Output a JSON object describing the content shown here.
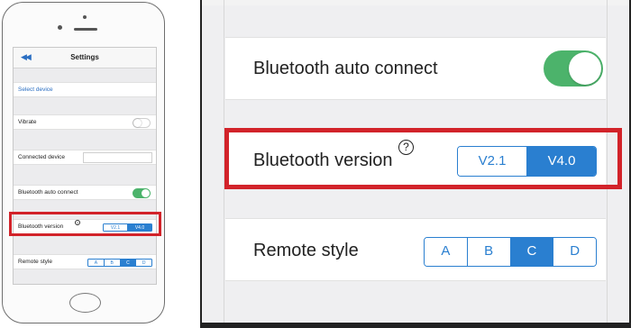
{
  "phone": {
    "nav": {
      "back_icon": "double-left-arrow",
      "title": "Settings"
    },
    "rows": {
      "select_device": "Select device",
      "vibrate": {
        "label": "Vibrate",
        "on": false
      },
      "connected_device": {
        "label": "Connected device",
        "value": ""
      },
      "bluetooth_auto_connect": {
        "label": "Bluetooth auto connect",
        "on": true
      },
      "bluetooth_version": {
        "label": "Bluetooth version",
        "help_icon": "?",
        "options": [
          "V2.1",
          "V4.0"
        ],
        "selected": "V4.0"
      },
      "remote_style": {
        "label": "Remote style",
        "options": [
          "A",
          "B",
          "C",
          "D"
        ],
        "selected": "C"
      }
    }
  },
  "zoom": {
    "bluetooth_auto_connect": {
      "label": "Bluetooth auto connect",
      "on": true
    },
    "bluetooth_version": {
      "label": "Bluetooth version",
      "help_icon": "?",
      "options": [
        "V2.1",
        "V4.0"
      ],
      "selected": "V4.0"
    },
    "remote_style": {
      "label": "Remote style",
      "options": [
        "A",
        "B",
        "C",
        "D"
      ],
      "selected": "C"
    }
  },
  "colors": {
    "accent": "#2a7fd0",
    "toggle_on": "#4cb36b",
    "highlight": "#d2232a"
  }
}
